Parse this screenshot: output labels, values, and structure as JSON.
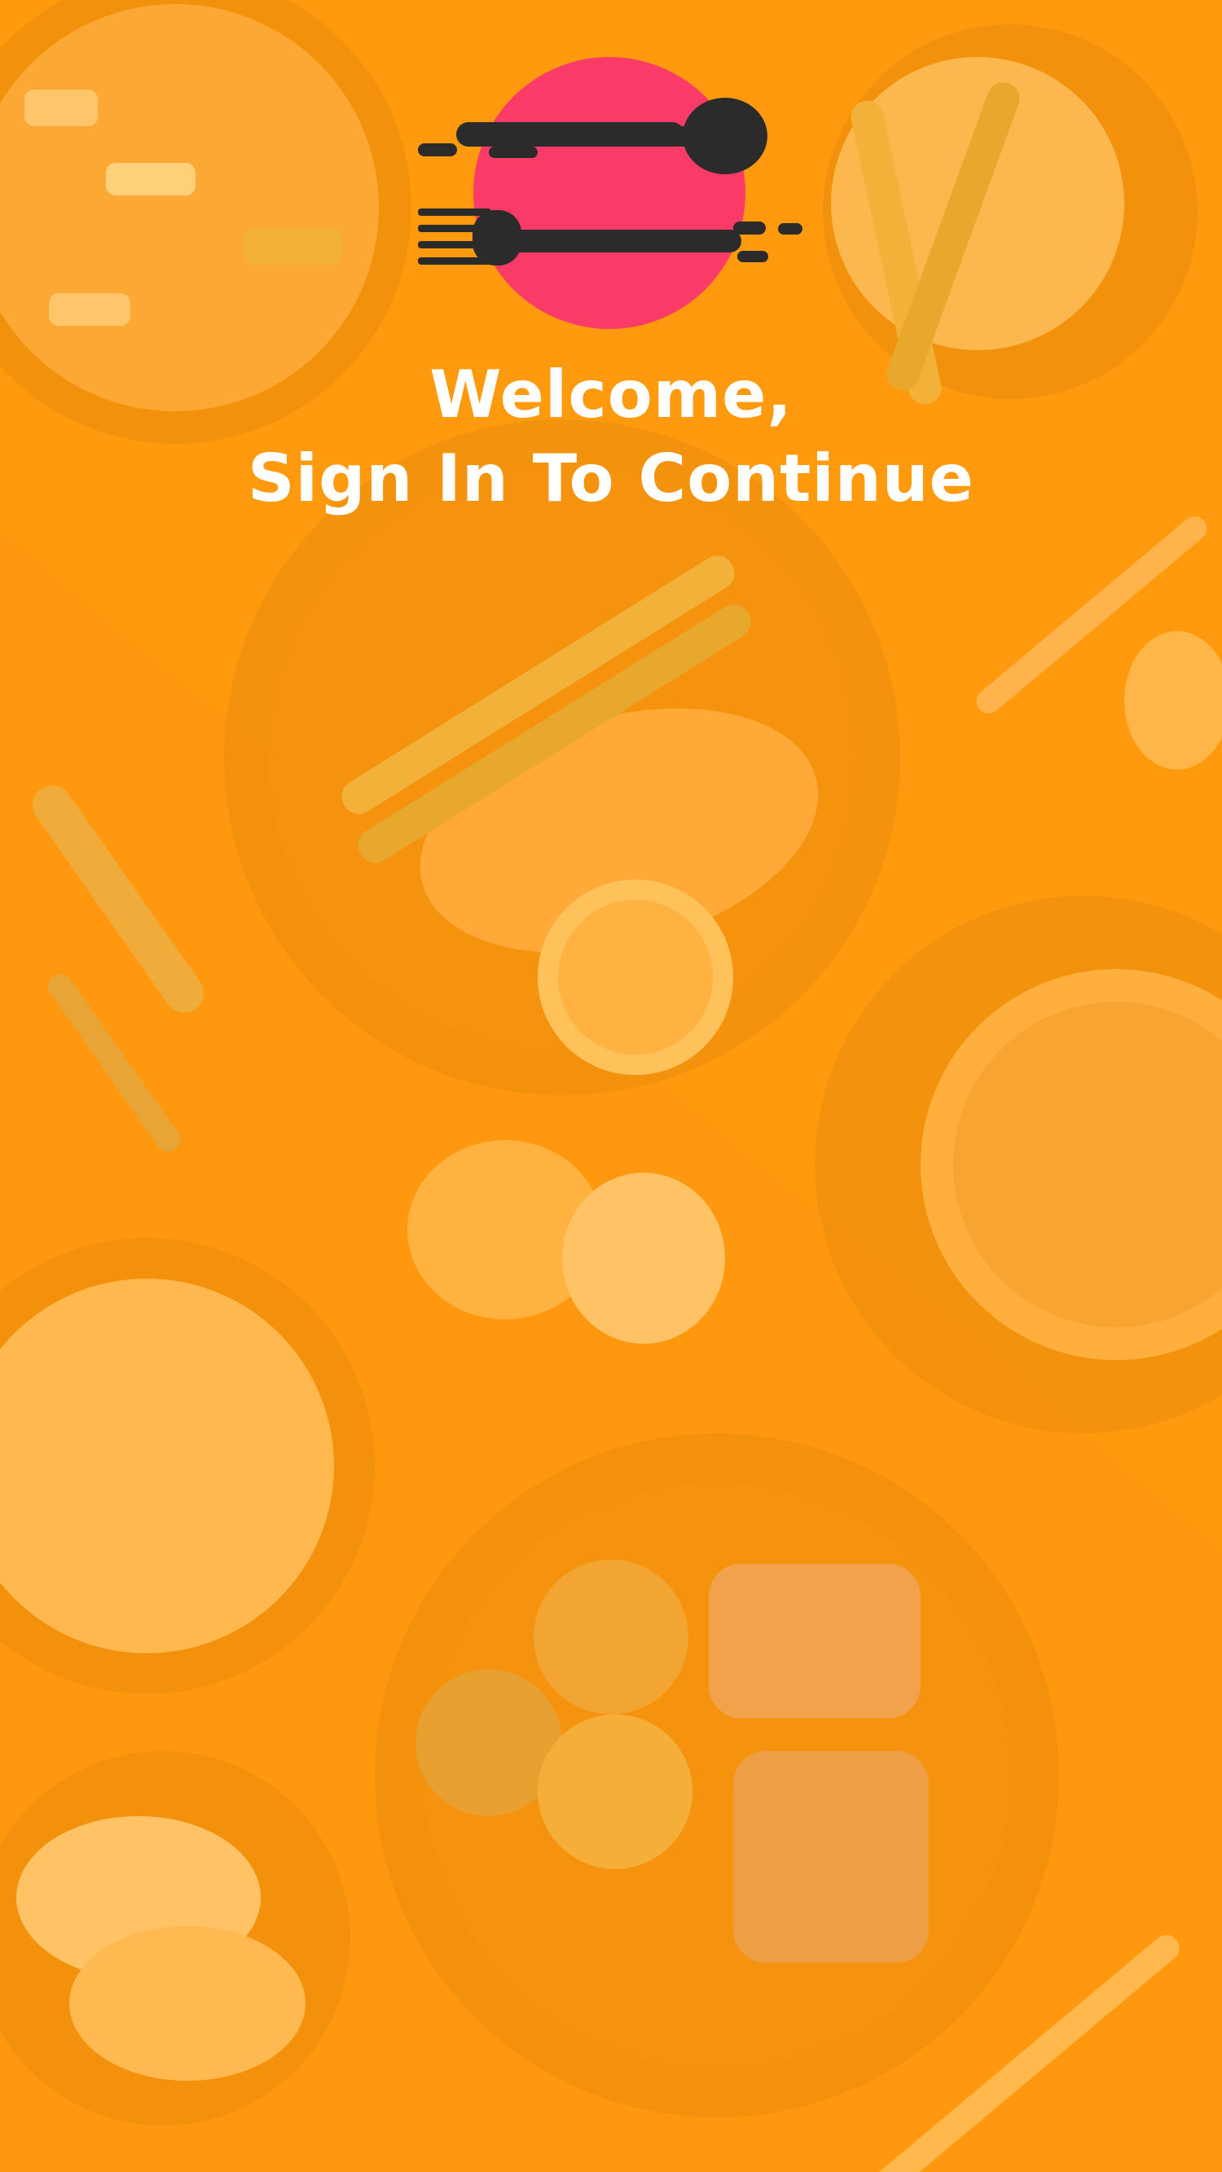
{
  "screen": {
    "name": "sign-in-splash",
    "background_color": "#FF9A0E",
    "accent_color": "#FB3B67",
    "icon_color": "#2B2B2B"
  },
  "logo": {
    "icons": [
      "spoon-icon",
      "fork-icon"
    ],
    "circle_color": "#FB3B67"
  },
  "welcome": {
    "line1": "Welcome,",
    "line2": "Sign In To Continue"
  },
  "background_photo": {
    "icons": [
      "plate-icon",
      "bowl-icon",
      "fork-icon",
      "knife-icon",
      "spoon-icon",
      "bread-icon",
      "lemon-icon"
    ]
  }
}
